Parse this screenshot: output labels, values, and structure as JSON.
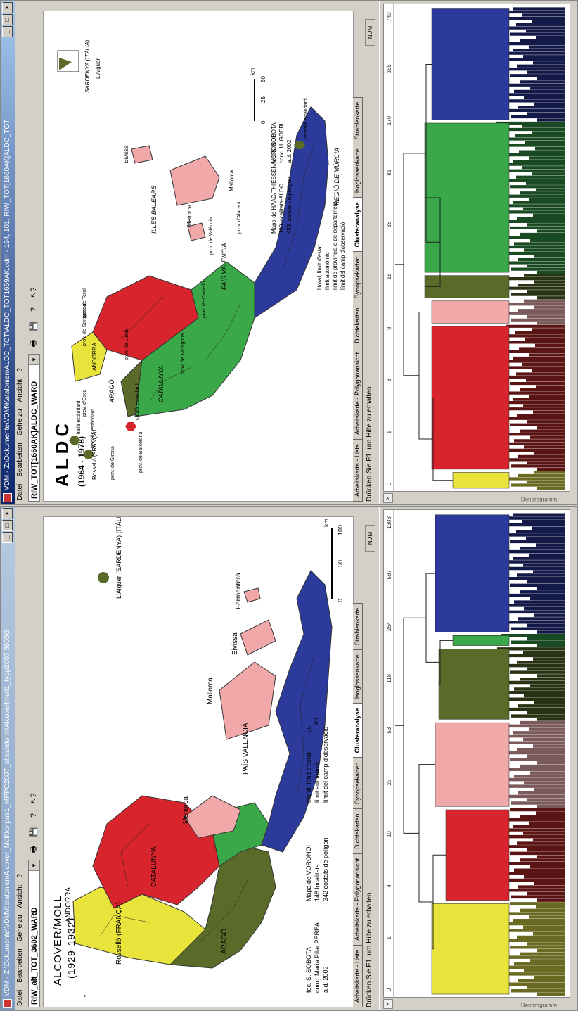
{
  "left": {
    "title": "VDM - Z:\\Dokumente\\VDM\\Katalonien\\Alcover_Moll\\korpus1_MPPC2007_altesteform\\Alcoverfmoll1_typp2007 3605G",
    "menu": [
      "Datei",
      "Bearbeiten",
      "Gehe zu",
      "Ansicht",
      "?"
    ],
    "combo": "RIW_alt_TOT_3602_WARD",
    "tabs": [
      "Arbeitskarte - Liste",
      "Arbeitskarte - Polygonansicht",
      "Dichtekarten",
      "Synopsekarten",
      "Clusteranalyse",
      "Isoglossenkarte",
      "Strahlenkarte"
    ],
    "active_tab": 4,
    "status": "Drücken Sie F1, um Hilfe zu erhalten.",
    "num": "NUM",
    "dendro_label": "Dendrogramm",
    "axis_ticks": [
      "0",
      "1",
      "4",
      "10",
      "23",
      "53",
      "118",
      "264",
      "587",
      "1303"
    ],
    "map": {
      "title": "ALCOVER/MOLL",
      "years": "(1929-1932)",
      "labels": {
        "andorra": "ANDORRA",
        "rossello": "Rosselló (FRANÇA)",
        "catalunya": "CATALUNYA",
        "arago": "ARAGÓ",
        "valencia": "PAÍS VALENCIÀ",
        "menorca": "Menorca",
        "mallorca": "Mallorca",
        "eivissa": "Eivissa",
        "formentera": "Formentera",
        "alguer": "L'Alguer (SARDENYA) (ITÀLIA)"
      },
      "scale": [
        "0",
        "50",
        "100",
        "km"
      ],
      "scale_small": [
        "0",
        "25",
        "km"
      ],
      "credits": [
        "fec. S. SOBOTA",
        "conc. Maria Pilar PEREA",
        "a.d. 2002"
      ],
      "mapa": [
        "Mapa de VORONOI",
        "148 localitats",
        "342 costats de polígon"
      ],
      "legend": [
        "litoral, límit d'estat",
        "límit autonòmic",
        "límit del camp d'observació"
      ]
    }
  },
  "right": {
    "title": "VDM - Z:\\Dokumente\\VDM\\Katalonien\\ALDC_TOT\\ALDC_TOT1659AK.vdm - 194, 101, RIW_TOT[1660AK]ALDC_TOT",
    "menu": [
      "Datei",
      "Bearbeiten",
      "Gehe zu",
      "Ansicht",
      "?"
    ],
    "combo": "RIW_TOT[1660AK]ALDC_WARD",
    "tabs": [
      "Arbeitskarte - Liste",
      "Arbeitskarte - Polygonansicht",
      "Dichtekarten",
      "Synopsekarten",
      "Clusteranalyse",
      "Isoglossenkarte",
      "Strahlenkarte"
    ],
    "active_tab": 4,
    "status": "Drücken Sie F1, um Hilfe zu erhalten.",
    "num": "NUM",
    "dendro_label": "Dendrogramm",
    "axis_ticks": [
      "0",
      "1",
      "3",
      "8",
      "18",
      "38",
      "81",
      "170",
      "355",
      "740"
    ],
    "map": {
      "title": "ALDC",
      "years": "(1964 - 1978)",
      "labels": {
        "andorra": "ANDORRA",
        "rossello": "Rosselló (FRANÇA)",
        "catalunya": "CATALUNYA",
        "arago": "ARAGÓ",
        "valencia": "PAÍS VALENCIÀ",
        "murcia": "REGIÓ DE MÚRCIA",
        "illes": "ILLES BALEARS",
        "menorca": "Menorca",
        "mallorca": "Mallorca",
        "eivissa": "Eivissa",
        "sardenya": "SARDENYA (ITÀLIA)",
        "alguer": "L'Alguer",
        "lleida": "prov. de Lleida",
        "girona": "prov. de Girona",
        "barcelona": "prov. de Barcelona",
        "tarragona": "prov. de Tarragona",
        "osca": "prov. d'Osca",
        "saragossa": "prov. de Saragossa",
        "terol": "prov. de Terol",
        "castello": "prov. de Castelló",
        "valenciaprov": "prov. de València",
        "alacant": "prov. d'Alacant",
        "frances": "francès estàndard",
        "italia": "italià estàndard",
        "catala": "català estàndard",
        "castella": "castellà estàndard"
      },
      "scale": [
        "0",
        "25",
        "50",
        "km"
      ],
      "credits": [
        "fec. S. SOBOTA",
        "conc. H. GOEBL",
        "a.d. 2002"
      ],
      "mapa": [
        "Mapa de HAAG/THIESSEN/VORONOI",
        "190 localitats-ALDC",
        "453 costats de polígon"
      ],
      "legend": [
        "litoral, límit d'estat",
        "límit autonòmic",
        "límit de província o de département",
        "límit del camp d'observació"
      ]
    }
  },
  "colors": {
    "title_active": "#3a6ea5",
    "title_inactive": "#8aa7c9",
    "yellow": "#e8e43c",
    "red": "#d8242c",
    "olive": "#5a6a28",
    "green": "#3aa848",
    "pink": "#f0a8a8",
    "blue": "#2c3a9c"
  }
}
